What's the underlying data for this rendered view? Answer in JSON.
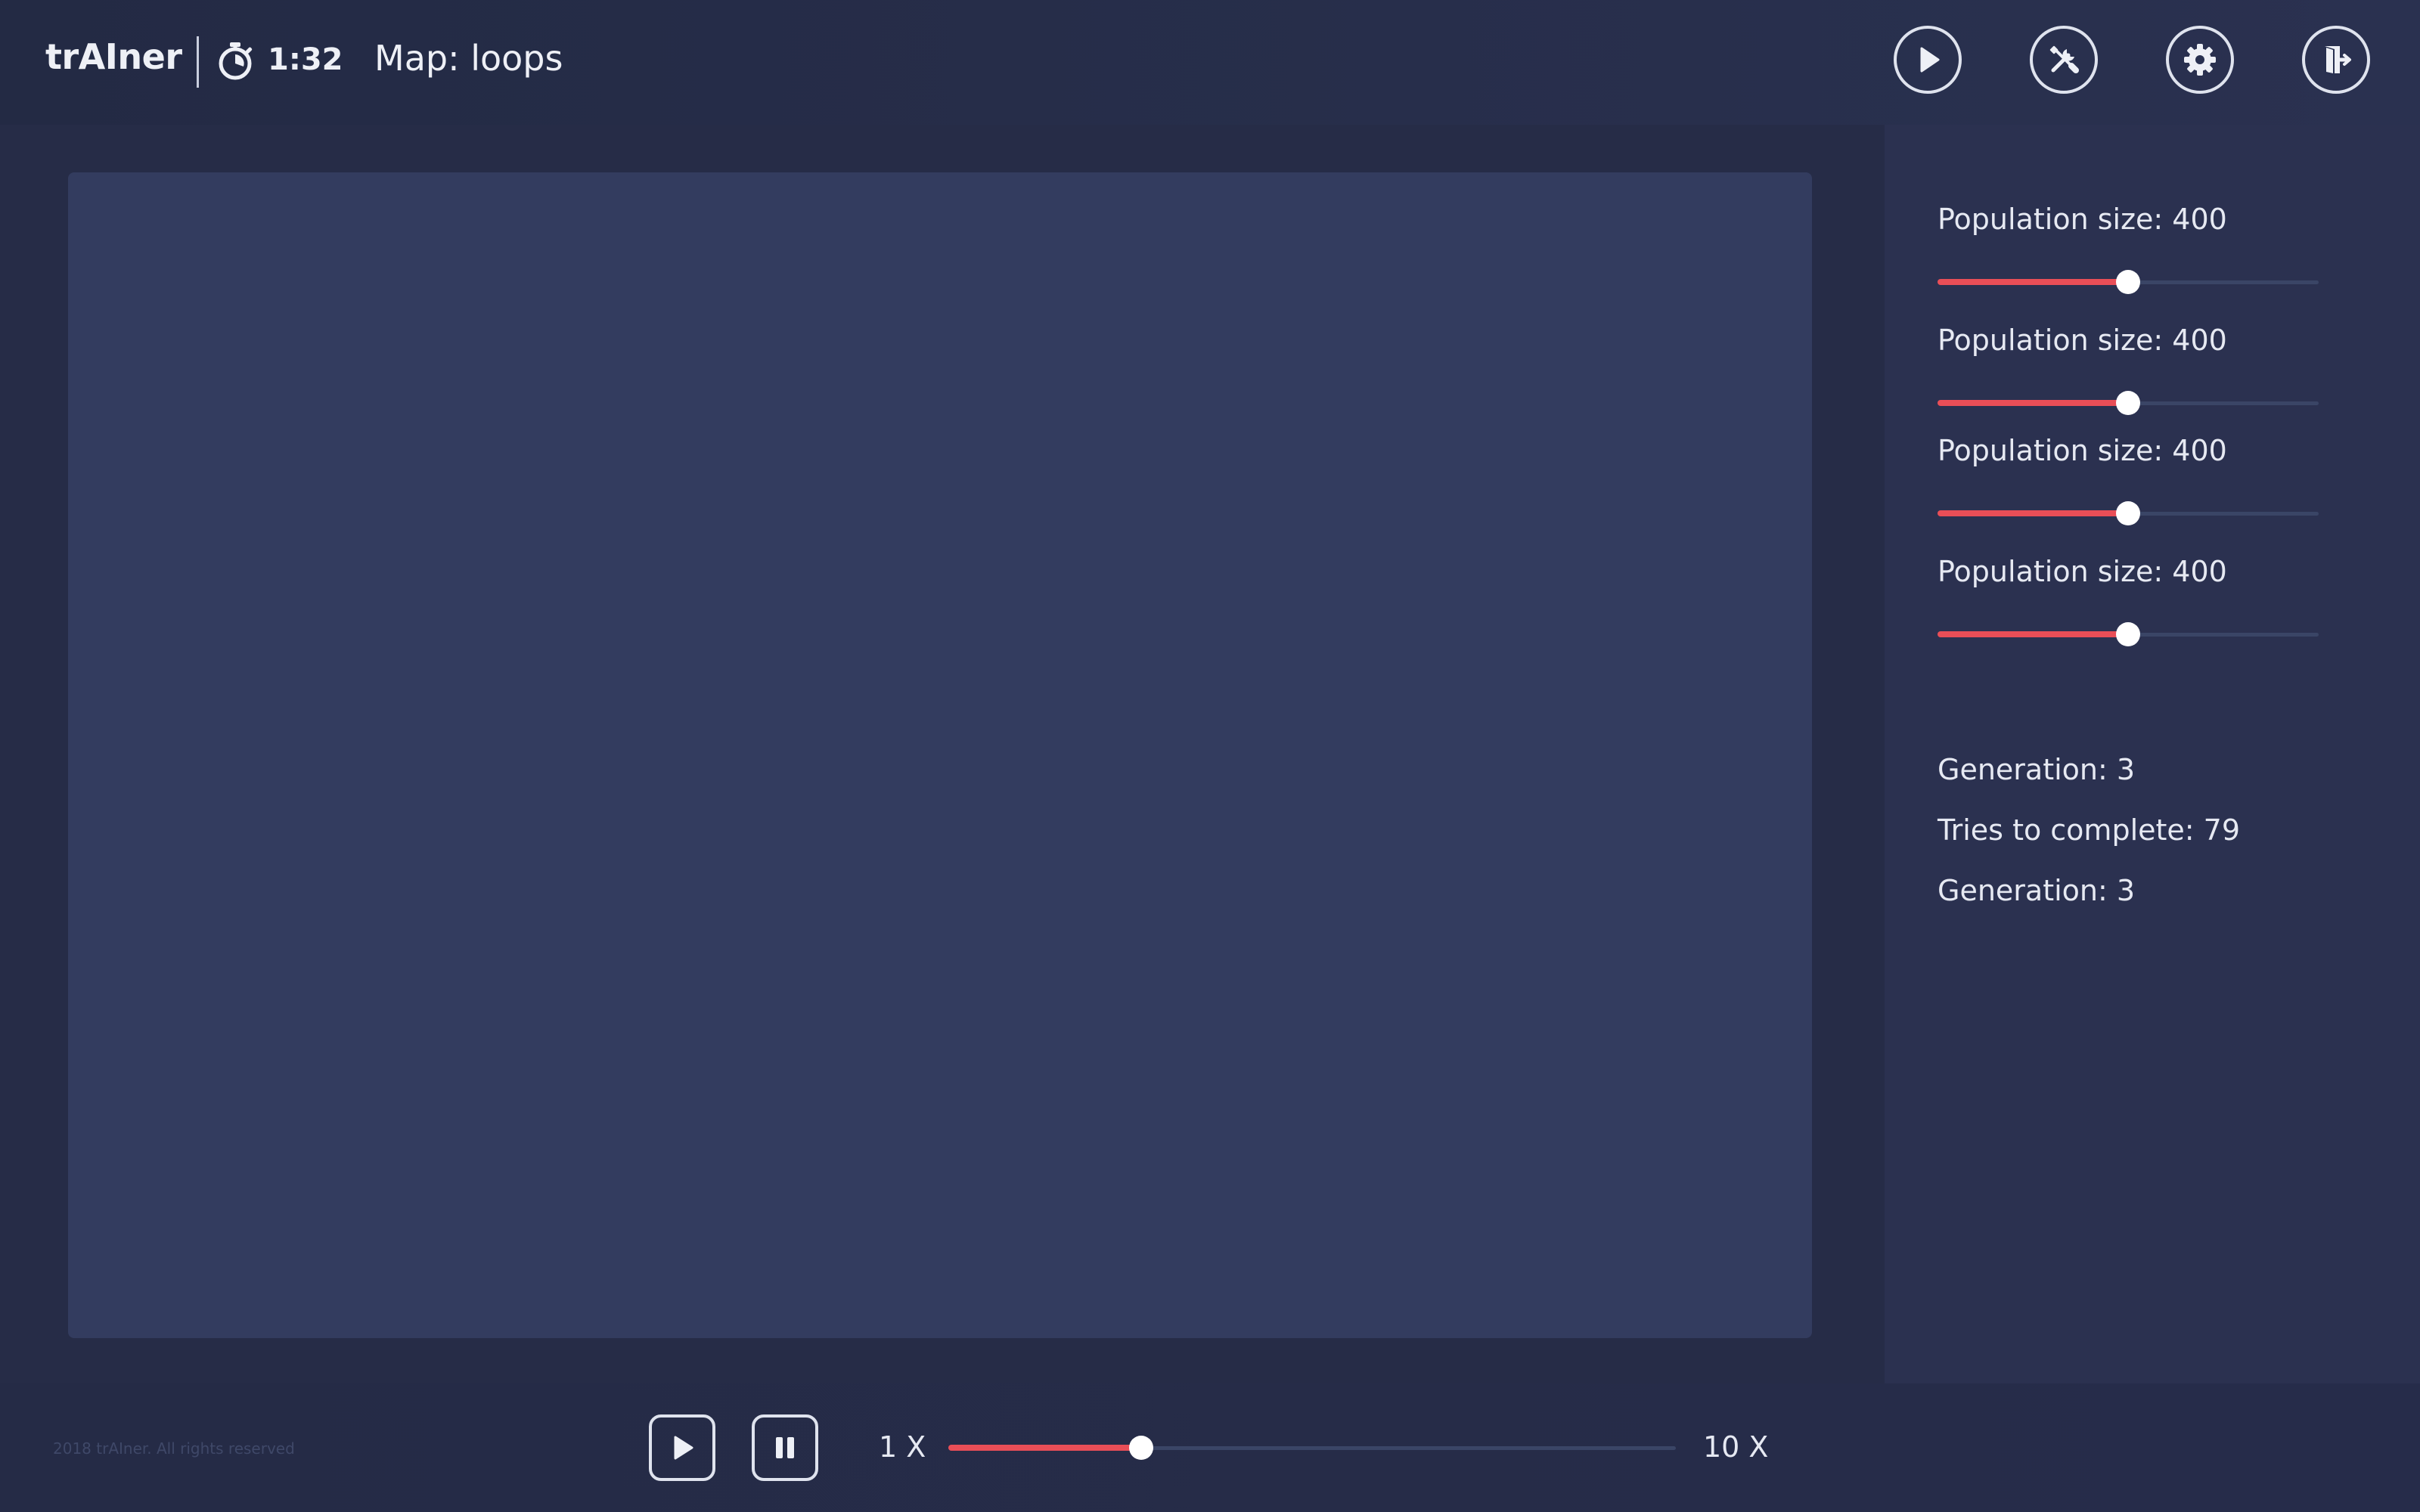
{
  "header": {
    "logo": "trAIner",
    "timer": "1:32",
    "map_label": "Map: loops",
    "icons": {
      "timer": "stopwatch-icon",
      "play": "play-icon",
      "tools": "tools-icon",
      "settings": "gear-icon",
      "exit": "exit-icon"
    }
  },
  "panel": {
    "params": [
      {
        "label": "Population size: 400",
        "value": 0.5
      },
      {
        "label": "Population size: 400",
        "value": 0.5
      },
      {
        "label": "Population size: 400",
        "value": 0.5
      },
      {
        "label": "Population size: 400",
        "value": 0.5
      }
    ],
    "stats": [
      "Generation: 3",
      "Tries to complete: 79",
      "Generation: 3"
    ]
  },
  "footer": {
    "copyright": "2018 trAIner. All rights reserved",
    "speed_min": "1 X",
    "speed_max": "10 X",
    "speed_value": 0.265,
    "icons": {
      "play": "play-icon",
      "pause": "pause-icon"
    }
  },
  "colors": {
    "accent": "#e94e57",
    "background": "#252b45",
    "canvas": "#333c5f",
    "panel": "#2b3150"
  }
}
